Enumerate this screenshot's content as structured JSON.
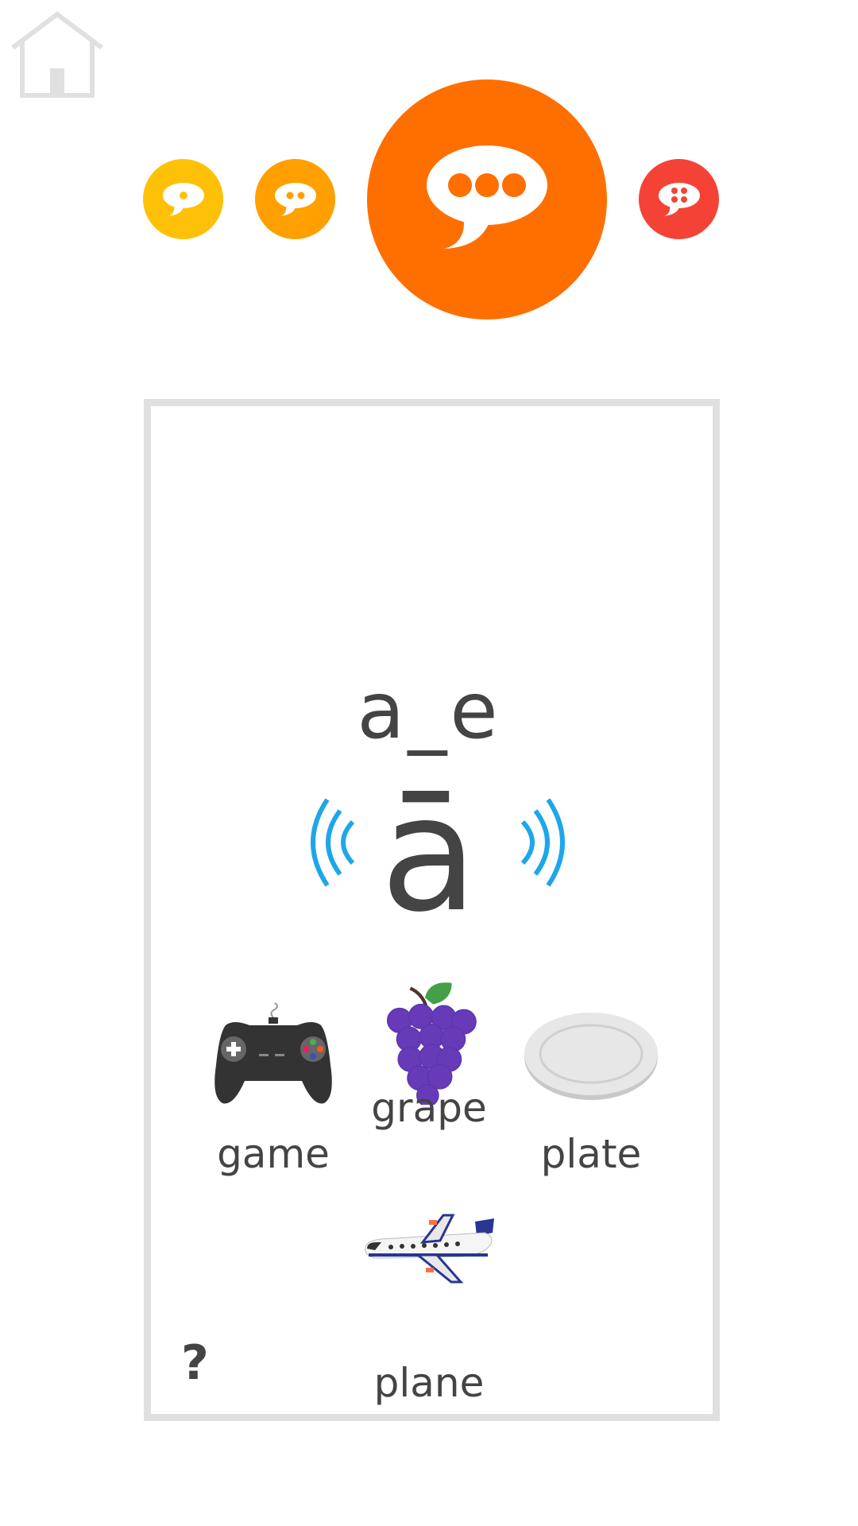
{
  "nav": {
    "home_icon": "home-icon"
  },
  "levels": [
    {
      "icon": "speech-bubble-one-dot-icon",
      "color": "#FFC107",
      "state": "available"
    },
    {
      "icon": "speech-bubble-two-dots-icon",
      "color": "#FFA000",
      "state": "available"
    },
    {
      "icon": "speech-bubble-three-dots-icon",
      "color": "#FF6F00",
      "state": "selected"
    },
    {
      "icon": "speech-bubble-four-dots-icon",
      "color": "#F44336",
      "state": "available"
    }
  ],
  "lesson": {
    "pattern": "a_e",
    "sound": "ā",
    "words": [
      {
        "label": "game",
        "icon": "game-controller-icon"
      },
      {
        "label": "grape",
        "icon": "grapes-icon"
      },
      {
        "label": "plate",
        "icon": "plate-icon"
      },
      {
        "label": "plane",
        "icon": "airplane-icon"
      }
    ]
  },
  "help": {
    "label": "?"
  },
  "colors": {
    "sound_wave": "#1EA7E8",
    "card_border": "#e0e0e0",
    "text": "#444444"
  }
}
